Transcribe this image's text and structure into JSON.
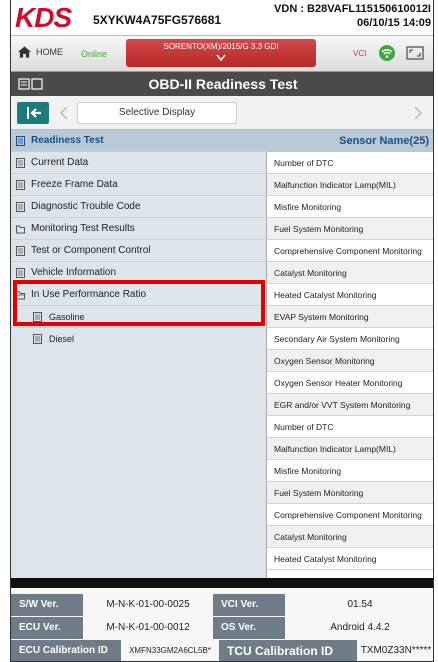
{
  "header": {
    "logo_main": "KDS",
    "vin": "5XYKW4A75FG576681",
    "vdn_line1": "VDN : B28VAFL115150610012I",
    "vdn_line2": "06/10/15 14:09"
  },
  "nav": {
    "home_label": "HOME",
    "online_label": "Online",
    "vehicle_label": "SORENTO(XM)/2015/G 3.3 GDI",
    "vci_label": "VCI"
  },
  "title": "OBD-II Readiness Test",
  "toolbar": {
    "selective_display_label": "Selective Display"
  },
  "menu": {
    "items": [
      {
        "label": "Readiness Test"
      },
      {
        "label": "Current Data"
      },
      {
        "label": "Freeze Frame Data"
      },
      {
        "label": "Diagnostic Trouble Code"
      },
      {
        "label": "Monitoring Test Results"
      },
      {
        "label": "Test or Component Control"
      },
      {
        "label": "Vehicle Information"
      },
      {
        "label": "In Use Performance Ratio"
      },
      {
        "label": "Gasoline"
      },
      {
        "label": "Diesel"
      }
    ]
  },
  "sensor_list": {
    "header": "Sensor Name(25)",
    "rows": [
      "Number of DTC",
      "Malfunction Indicator Lamp(MIL)",
      "Misfire Monitoring",
      "Fuel System Monitoring",
      "Comprehensive Component Monitoring",
      "Catalyst Monitoring",
      "Heated Catalyst Monitoring",
      "EVAP System Monitoring",
      "Secondary Air System Monitoring",
      "Oxygen Sensor Monitoring",
      "Oxygen Sensor Heater Monitoring",
      "EGR and/or VVT System Monitoring",
      "Number of DTC",
      "Malfunction Indicator Lamp(MIL)",
      "Misfire Monitoring",
      "Fuel System Monitoring",
      "Comprehensive Component Monitoring",
      "Catalyst Monitoring",
      "Heated Catalyst Monitoring"
    ]
  },
  "footer": {
    "sw_ver_label": "S/W Ver.",
    "sw_ver_value": "M-N-K-01-00-0025",
    "vci_ver_label": "VCI Ver.",
    "vci_ver_value": "01.54",
    "ecu_ver_label": "ECU Ver.",
    "ecu_ver_value": "M-N-K-01-00-0012",
    "os_ver_label": "OS Ver.",
    "os_ver_value": "Android 4.4.2",
    "ecu_cal_label": "ECU Calibration ID",
    "ecu_cal_value": "XMFN33GM2A6CL5B*",
    "tcu_cal_label": "TCU Calibration ID",
    "tcu_cal_value": "TXM0Z33N*****"
  },
  "colors": {
    "brand_red": "#c8102e",
    "highlight_red": "#e00000",
    "menu_bg": "#dde4ea",
    "header_blue": "#1a4e8a",
    "back_button": "#1f7a7c"
  },
  "icons": {
    "home": "home-icon",
    "wifi": "wifi-icon",
    "screen": "screen-icon",
    "back": "back-arrow-icon"
  }
}
